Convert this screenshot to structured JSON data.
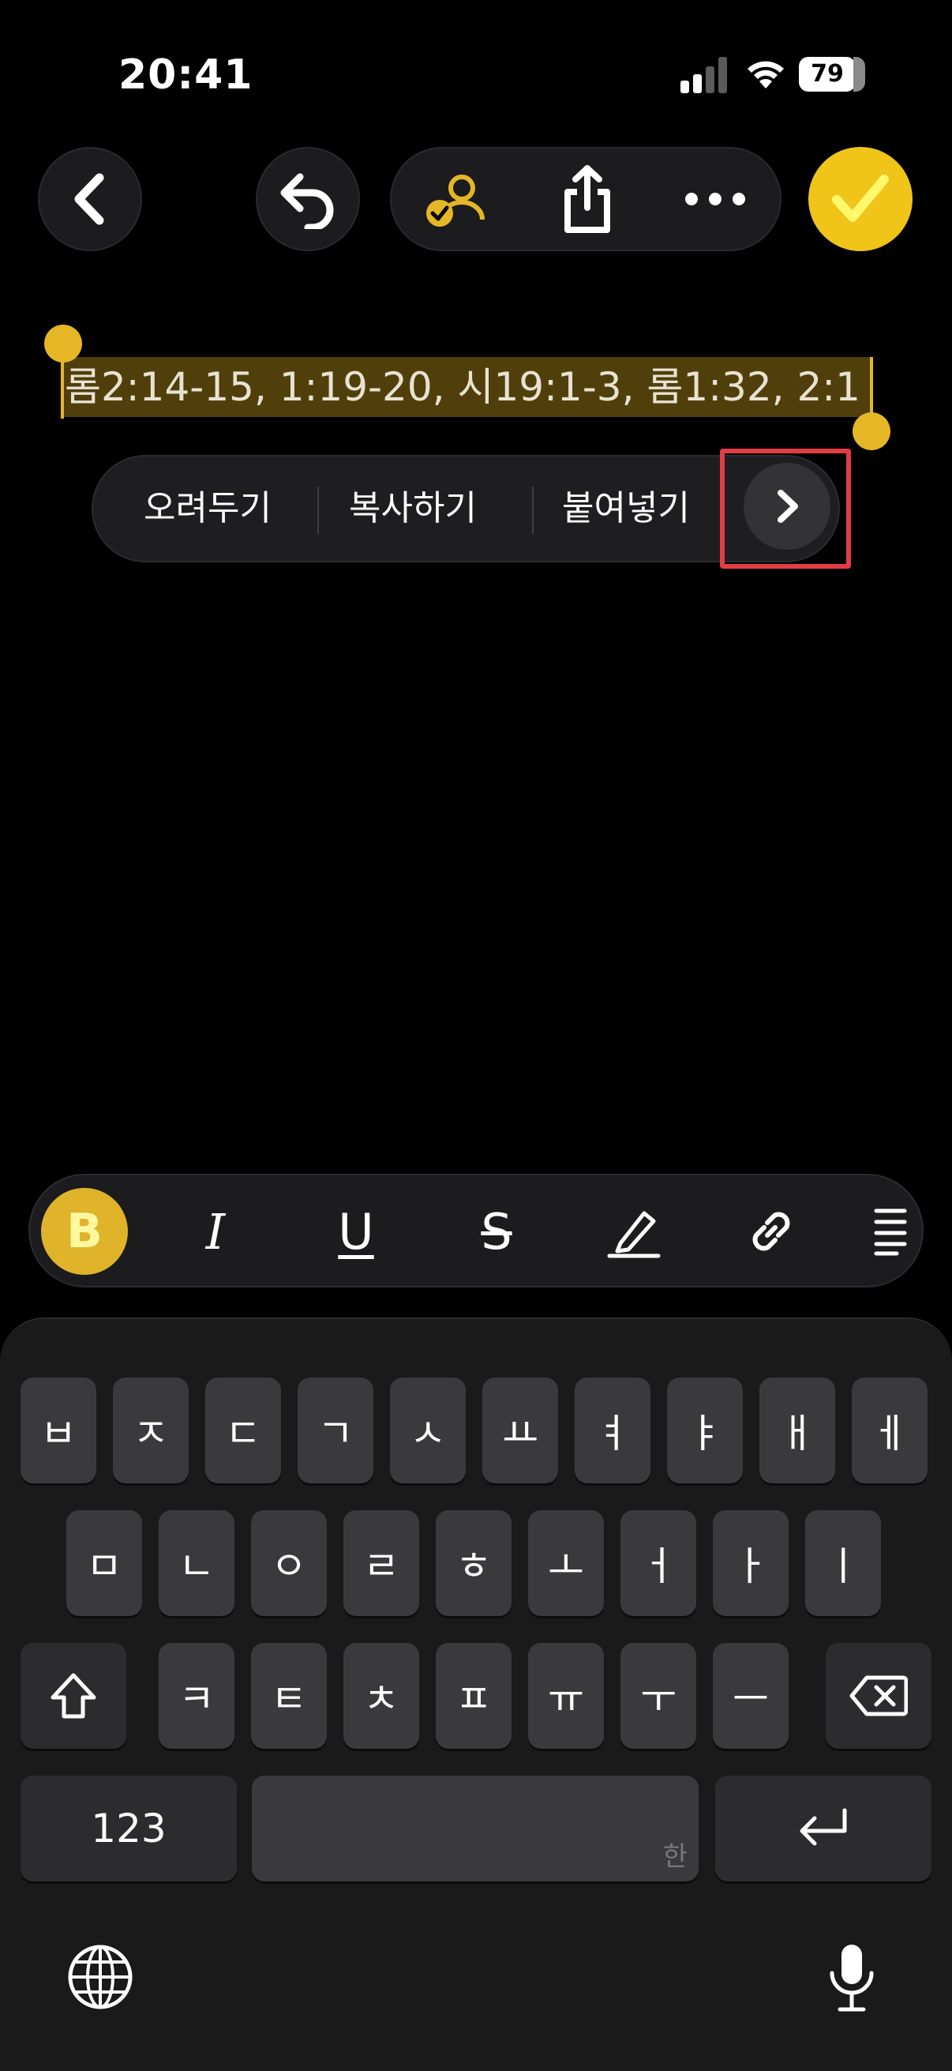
{
  "status": {
    "time": "20:41",
    "battery": "79"
  },
  "toolbar": {
    "back_icon": "chevron-left-icon",
    "undo_icon": "undo-icon",
    "collab_icon": "collaborator-icon",
    "share_icon": "share-icon",
    "more_icon": "ellipsis-icon",
    "done_icon": "checkmark-icon",
    "accent_color": "#f0c419"
  },
  "note": {
    "selected_text": "롬2:14-15, 1:19-20, 시19:1-3, 롬1:32, 2:1"
  },
  "edit_menu": {
    "items": [
      {
        "label": "오려두기"
      },
      {
        "label": "복사하기"
      },
      {
        "label": "붙여넣기"
      }
    ],
    "next_icon": "chevron-right-icon",
    "highlight_color": "#e23c44"
  },
  "format_bar": {
    "bold": "B",
    "italic": "I",
    "underline": "U",
    "strikethrough": "S",
    "highlight_icon": "pencil-icon",
    "link_icon": "link-icon",
    "list_icon": "list-icon"
  },
  "keyboard": {
    "row1": [
      "ㅂ",
      "ㅈ",
      "ㄷ",
      "ㄱ",
      "ㅅ",
      "ㅛ",
      "ㅕ",
      "ㅑ",
      "ㅐ",
      "ㅔ"
    ],
    "row2": [
      "ㅁ",
      "ㄴ",
      "ㅇ",
      "ㄹ",
      "ㅎ",
      "ㅗ",
      "ㅓ",
      "ㅏ",
      "ㅣ"
    ],
    "row3": [
      "ㅋ",
      "ㅌ",
      "ㅊ",
      "ㅍ",
      "ㅠ",
      "ㅜ",
      "ㅡ"
    ],
    "numbers_label": "123",
    "space_hint": "한",
    "shift_icon": "shift-icon",
    "delete_icon": "delete-icon",
    "return_icon": "return-icon",
    "globe_icon": "globe-icon",
    "mic_icon": "microphone-icon"
  }
}
